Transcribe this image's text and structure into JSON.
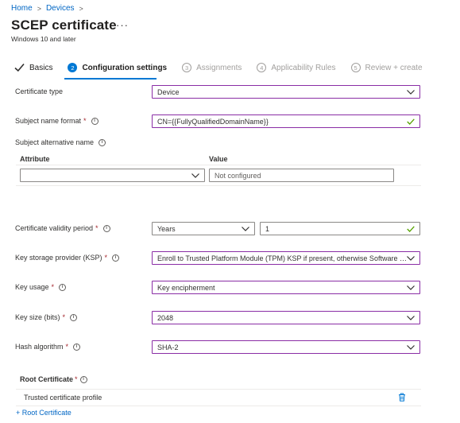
{
  "breadcrumb": {
    "home": "Home",
    "devices": "Devices",
    "separator": ">"
  },
  "header": {
    "title": "SCEP certificate",
    "more": "···",
    "subtitle": "Windows 10 and later"
  },
  "steps": [
    {
      "label": "Basics",
      "state": "done",
      "num": ""
    },
    {
      "label": "Configuration settings",
      "state": "active",
      "num": "2"
    },
    {
      "label": "Assignments",
      "state": "todo",
      "num": "3"
    },
    {
      "label": "Applicability Rules",
      "state": "todo",
      "num": "4"
    },
    {
      "label": "Review + create",
      "state": "todo",
      "num": "5"
    }
  ],
  "form": {
    "certificate_type": {
      "label": "Certificate type",
      "value": "Device"
    },
    "subject_name_format": {
      "label": "Subject name format",
      "required": "*",
      "value": "CN={{FullyQualifiedDomainName}}"
    },
    "subject_alt_name": {
      "label": "Subject alternative name",
      "col_attribute": "Attribute",
      "col_value": "Value",
      "attribute_value": "",
      "value_placeholder": "Not configured"
    },
    "validity_period": {
      "label": "Certificate validity period",
      "required": "*",
      "unit": "Years",
      "value": "1"
    },
    "ksp": {
      "label": "Key storage provider (KSP)",
      "required": "*",
      "value": "Enroll to Trusted Platform Module (TPM) KSP if present, otherwise Software K..."
    },
    "key_usage": {
      "label": "Key usage",
      "required": "*",
      "value": "Key encipherment"
    },
    "key_size": {
      "label": "Key size (bits)",
      "required": "*",
      "value": "2048"
    },
    "hash_algorithm": {
      "label": "Hash algorithm",
      "required": "*",
      "value": "SHA-2"
    }
  },
  "root_certificate": {
    "heading": "Root Certificate",
    "required": "*",
    "item": "Trusted certificate profile",
    "add_link": "+ Root Certificate"
  },
  "info_glyph": "i",
  "colors": {
    "accent": "#0078d4",
    "field_border": "#8a2da5",
    "link": "#0066c4",
    "valid_check": "#57a300",
    "required": "#a4262c"
  }
}
